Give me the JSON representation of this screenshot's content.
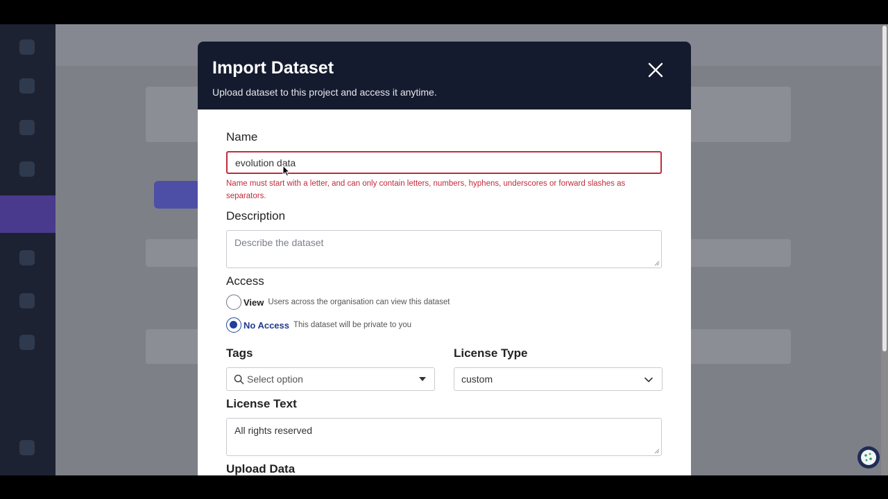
{
  "modal": {
    "title": "Import Dataset",
    "subtitle": "Upload dataset to this project and access it anytime."
  },
  "form": {
    "name": {
      "label": "Name",
      "value": "evolution data",
      "error": "Name must start with a letter, and can only contain letters, numbers, hyphens, underscores or forward slashes as separators."
    },
    "description": {
      "label": "Description",
      "placeholder": "Describe the dataset"
    },
    "access": {
      "label": "Access",
      "options": [
        {
          "label": "View",
          "description": "Users across the organisation can view this dataset",
          "selected": false
        },
        {
          "label": "No Access",
          "description": "This dataset will be private to you",
          "selected": true
        }
      ]
    },
    "tags": {
      "label": "Tags",
      "placeholder": "Select option"
    },
    "license_type": {
      "label": "License Type",
      "value": "custom"
    },
    "license_text": {
      "label": "License Text",
      "value": "All rights reserved"
    },
    "upload": {
      "label": "Upload Data"
    }
  },
  "colors": {
    "header_bg": "#141b2e",
    "error": "#c22a3a",
    "accent": "#1f3fa0"
  }
}
